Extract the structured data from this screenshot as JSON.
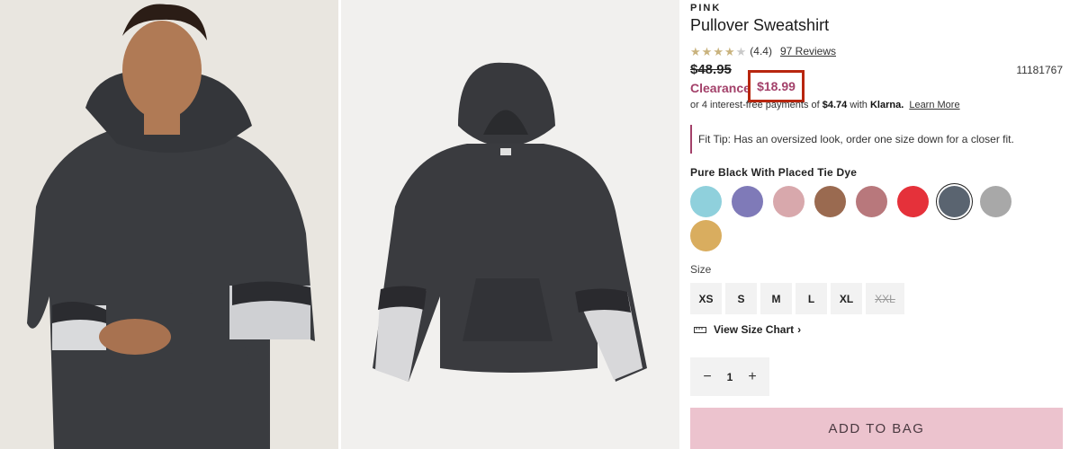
{
  "product": {
    "brand": "PINK",
    "title": "Pullover Sweatshirt",
    "rating": 4.4,
    "rating_text": "(4.4)",
    "stars_filled": 4,
    "stars_total": 5,
    "reviews_link": "97 Reviews",
    "original_price": "$48.95",
    "sku": "11181767",
    "clearance_label": "Clearance",
    "sale_price": "$18.99",
    "klarna_prefix": "or 4 interest-free payments of",
    "klarna_amount": "$4.74",
    "klarna_with": "with",
    "klarna_brand": "Klarna.",
    "klarna_learn_more": "Learn More",
    "fit_tip": "Fit Tip: Has an oversized look, order one size down for a closer fit.",
    "selected_color": "Pure Black With Placed Tie Dye",
    "colors": [
      {
        "name": "light-blue-tie-dye",
        "color": "#8fd0dc"
      },
      {
        "name": "lavender-tie-dye",
        "color": "#7f7ab8"
      },
      {
        "name": "pink-burgundy-tie-dye",
        "color": "#d8a8ac"
      },
      {
        "name": "mocha",
        "color": "#9a6a50"
      },
      {
        "name": "mauve-camo",
        "color": "#b8787c"
      },
      {
        "name": "red",
        "color": "#e5313a"
      },
      {
        "name": "pure-black-tie-dye",
        "color": "#5a6470",
        "selected": true
      },
      {
        "name": "heather-grey",
        "color": "#a8a8a8"
      },
      {
        "name": "mustard",
        "color": "#d9ad5f"
      }
    ],
    "size_label": "Size",
    "sizes": [
      {
        "label": "XS",
        "available": true
      },
      {
        "label": "S",
        "available": true
      },
      {
        "label": "M",
        "available": true
      },
      {
        "label": "L",
        "available": true
      },
      {
        "label": "XL",
        "available": true
      },
      {
        "label": "XXL",
        "available": false
      }
    ],
    "size_chart_link": "View Size Chart",
    "quantity": "1",
    "add_to_bag": "ADD TO BAG"
  },
  "icons": {
    "qty_minus": "minus-icon",
    "qty_plus": "plus-icon",
    "ruler": "ruler-icon",
    "chevron": "chevron-right-icon"
  },
  "colors": {
    "accent": "#a3416a",
    "highlight_box": "#b8260f",
    "add_to_bag_bg": "#ecc3ce",
    "star": "#c9b37e"
  }
}
